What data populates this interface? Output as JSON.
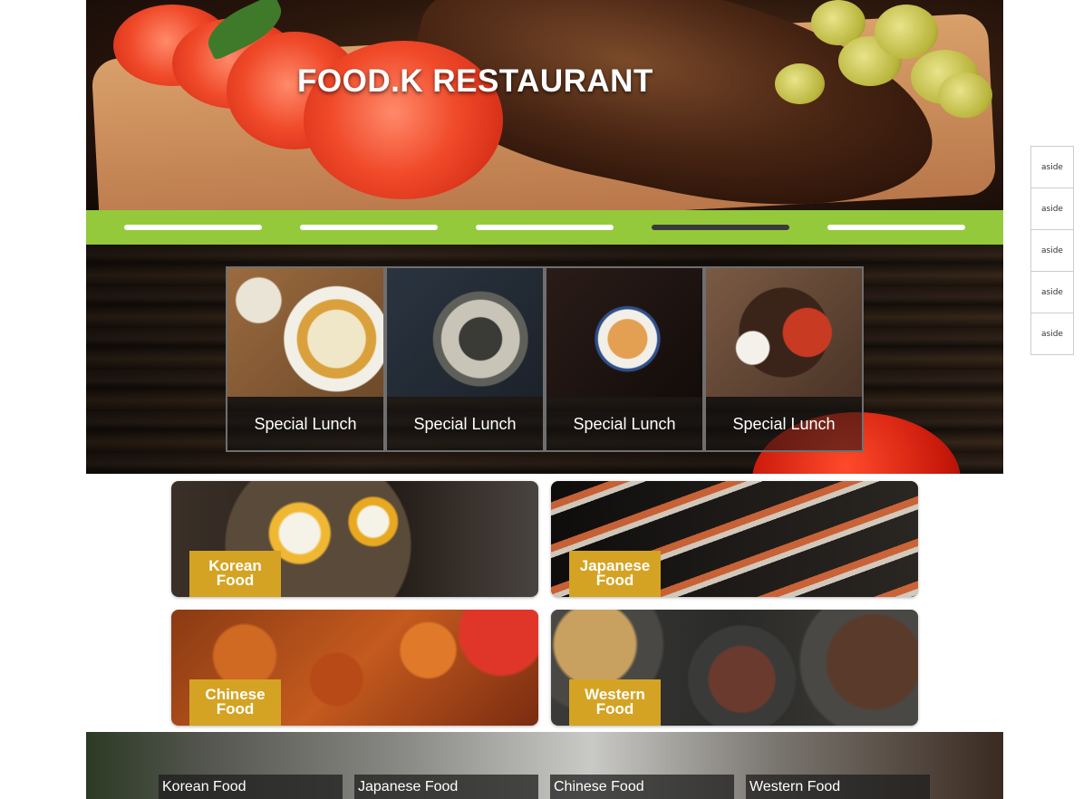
{
  "hero": {
    "title": "FOOD.K RESTAURANT"
  },
  "nav": {
    "items": [
      {
        "label": "",
        "active": false
      },
      {
        "label": "",
        "active": false
      },
      {
        "label": "",
        "active": false
      },
      {
        "label": "",
        "active": true
      },
      {
        "label": "",
        "active": false
      }
    ],
    "colors": {
      "bar": "#94c93b",
      "item": "#ffffff",
      "active_item": "#3a3a3a"
    }
  },
  "special": {
    "cards": [
      {
        "label": "Special Lunch"
      },
      {
        "label": "Special Lunch"
      },
      {
        "label": "Special Lunch"
      },
      {
        "label": "Special Lunch"
      }
    ]
  },
  "categories": [
    {
      "label_line1": "Korean",
      "label_line2": "Food"
    },
    {
      "label_line1": "Japanese",
      "label_line2": "Food"
    },
    {
      "label_line1": "Chinese",
      "label_line2": "Food"
    },
    {
      "label_line1": "Western",
      "label_line2": "Food"
    }
  ],
  "category_badge_color": "#d5a323",
  "strip_tabs": [
    {
      "label": "Korean Food"
    },
    {
      "label": "Japanese Food"
    },
    {
      "label": "Chinese Food"
    },
    {
      "label": "Western Food"
    }
  ],
  "aside": {
    "items": [
      {
        "label": "aside"
      },
      {
        "label": "aside"
      },
      {
        "label": "aside"
      },
      {
        "label": "aside"
      },
      {
        "label": "aside"
      }
    ]
  }
}
